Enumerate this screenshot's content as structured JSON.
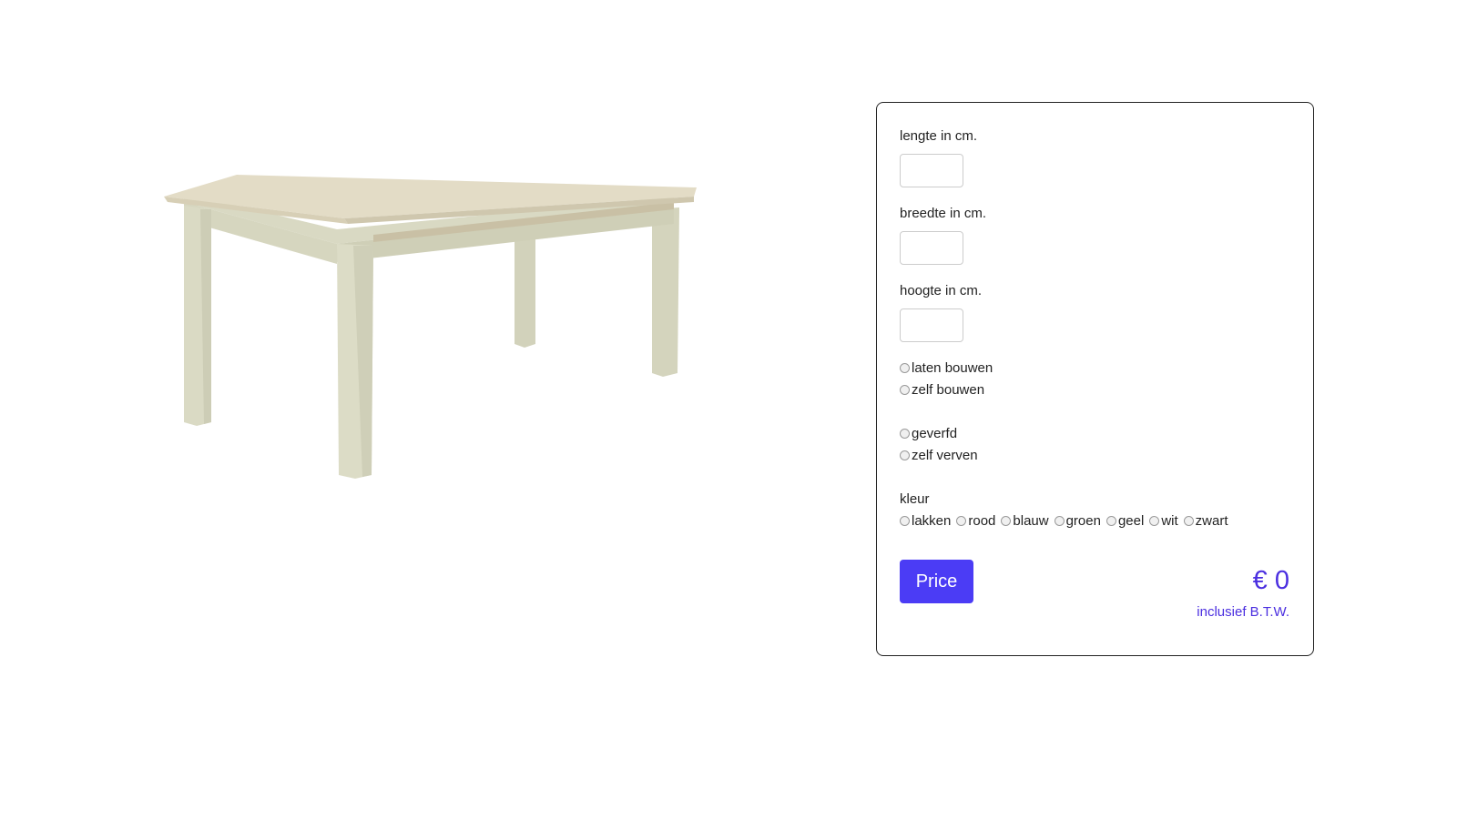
{
  "product": {
    "image_icon": "wooden-table-image",
    "colors": {
      "top": "#e3dcc6",
      "body": "#d8d8c2",
      "shadow": "#c2c2a8"
    }
  },
  "form": {
    "length_label": "lengte in cm.",
    "length_value": "",
    "width_label": "breedte in cm.",
    "width_value": "",
    "height_label": "hoogte in cm.",
    "height_value": "",
    "build_options": [
      "laten bouwen",
      "zelf bouwen"
    ],
    "paint_options": [
      "geverfd",
      "zelf verven"
    ],
    "color_label": "kleur",
    "color_options": [
      "lakken",
      "rood",
      "blauw",
      "groen",
      "geel",
      "wit",
      "zwart"
    ],
    "price_button_label": "Price",
    "price_value": "€ 0",
    "vat_note": "inclusief B.T.W.",
    "accent_color": "#4b3cf5"
  }
}
